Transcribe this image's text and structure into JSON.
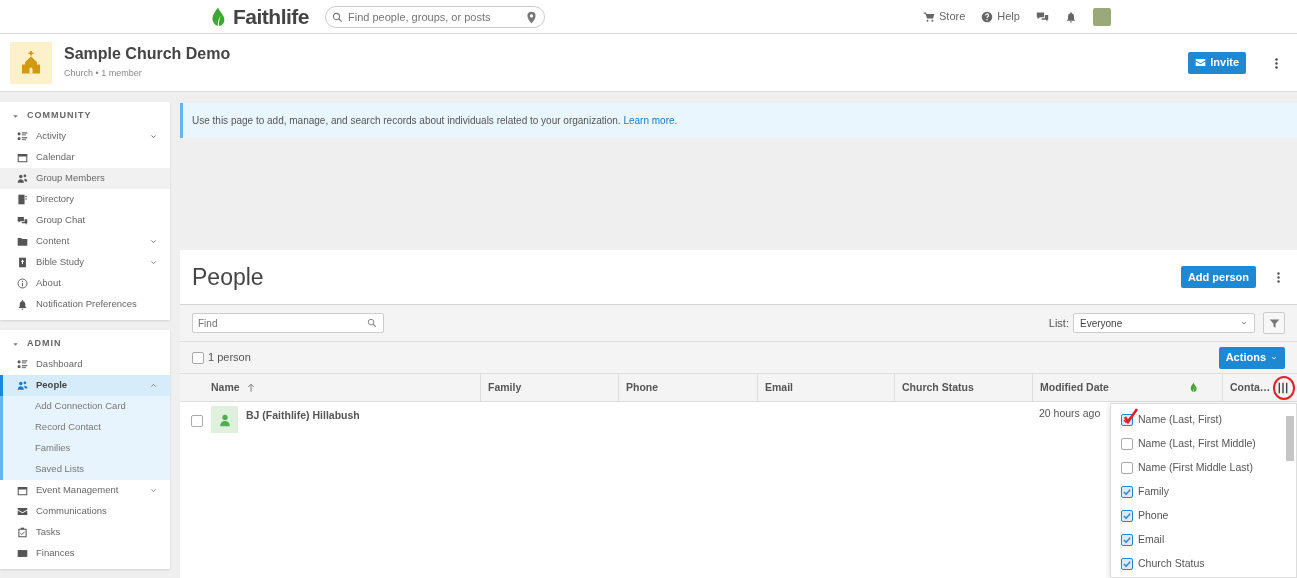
{
  "topbar": {
    "brand": "Faithlife",
    "search": {
      "placeholder": "Find people, groups, or posts"
    },
    "links": [
      {
        "label": "Store"
      },
      {
        "label": "Help"
      }
    ]
  },
  "header": {
    "title": "Sample Church Demo",
    "subtitle": "Church • 1 member",
    "invite": "Invite"
  },
  "sidebar": {
    "sections": [
      {
        "title": "COMMUNITY",
        "expanded": true,
        "items": [
          {
            "label": "Activity",
            "selected": false,
            "highlighted": false,
            "expanded": false
          },
          {
            "label": "Calendar",
            "selected": false,
            "highlighted": false
          },
          {
            "label": "Group Members",
            "selected": false,
            "highlighted": true
          },
          {
            "label": "Directory",
            "selected": false,
            "highlighted": false
          },
          {
            "label": "Group Chat",
            "selected": false,
            "highlighted": false
          },
          {
            "label": "Content",
            "selected": false,
            "highlighted": false,
            "expanded": false
          },
          {
            "label": "Bible Study",
            "selected": false,
            "highlighted": false,
            "expanded": false
          },
          {
            "label": "About",
            "selected": false,
            "highlighted": false
          },
          {
            "label": "Notification Preferences",
            "selected": false,
            "highlighted": false
          }
        ]
      },
      {
        "title": "ADMIN",
        "expanded": true,
        "items": [
          {
            "label": "Dashboard",
            "selected": false,
            "highlighted": false
          },
          {
            "label": "People",
            "selected": true,
            "highlighted": false,
            "expanded": true,
            "children": [
              {
                "label": "Add Connection Card",
                "selected": false
              },
              {
                "label": "Record Contact",
                "selected": false
              },
              {
                "label": "Families",
                "selected": false
              },
              {
                "label": "Saved Lists",
                "selected": false
              }
            ]
          },
          {
            "label": "Event Management",
            "selected": false,
            "highlighted": false,
            "expanded": false
          },
          {
            "label": "Communications",
            "selected": false,
            "highlighted": false
          },
          {
            "label": "Tasks",
            "selected": false,
            "highlighted": false
          },
          {
            "label": "Finances",
            "selected": false,
            "highlighted": false
          }
        ]
      }
    ]
  },
  "notice": {
    "text": "Use this page to add, manage, and search records about individuals related to your organization.",
    "link": "Learn more."
  },
  "people": {
    "title": "People",
    "add_button": "Add person",
    "find": {
      "placeholder": "Find"
    },
    "list_label": "List:",
    "list_value": "Everyone",
    "count": "1 person",
    "select_all": false,
    "actions": "Actions",
    "columns": [
      {
        "kind": "text",
        "label": "Name",
        "sorted_ascending": true
      },
      {
        "kind": "text",
        "label": "Family"
      },
      {
        "kind": "text",
        "label": "Phone"
      },
      {
        "kind": "text",
        "label": "Email"
      },
      {
        "kind": "text",
        "label": "Church Status"
      },
      {
        "kind": "text",
        "label": "Modified Date"
      },
      {
        "kind": "icon"
      },
      {
        "kind": "text",
        "label": "Conta…"
      }
    ],
    "rows": [
      {
        "checked": false,
        "name": "BJ (Faithlife) Hillabush",
        "modified_date": "20 hours ago"
      }
    ],
    "column_menu": {
      "circled": true,
      "items": [
        {
          "label": "Name (Last, First)",
          "checked": true,
          "marked": true
        },
        {
          "label": "Name (Last, First Middle)",
          "checked": false,
          "marked": false
        },
        {
          "label": "Name (First Middle Last)",
          "checked": false,
          "marked": false
        },
        {
          "label": "Family",
          "checked": true,
          "marked": false
        },
        {
          "label": "Phone",
          "checked": true,
          "marked": false
        },
        {
          "label": "Email",
          "checked": true,
          "marked": false
        },
        {
          "label": "Church Status",
          "checked": true,
          "marked": false
        }
      ]
    }
  }
}
